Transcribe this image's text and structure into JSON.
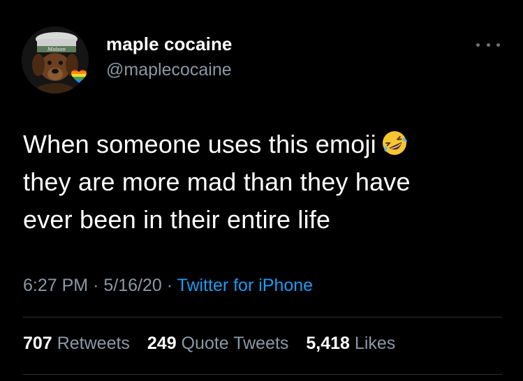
{
  "author": {
    "display_name": "maple cocaine",
    "handle": "@maplecocaine",
    "avatar_icon": "dog-avatar-icon",
    "badge_icon": "rainbow-heart-icon"
  },
  "tweet": {
    "lines": [
      "When someone uses this emoji",
      "they are more mad than they have",
      "ever been in their entire life"
    ],
    "emoji_icon": "rolling-on-floor-laughing-icon"
  },
  "meta": {
    "time": "6:27 PM",
    "separator": "·",
    "date": "5/16/20",
    "source": "Twitter for iPhone"
  },
  "stats": {
    "retweets_count": "707",
    "retweets_label": "Retweets",
    "quotes_count": "249",
    "quotes_label": "Quote Tweets",
    "likes_count": "5,418",
    "likes_label": "Likes"
  },
  "colors": {
    "background": "#000000",
    "text": "#ffffff",
    "secondary": "#8b98a5",
    "link": "#1d9bf0",
    "divider": "#2f3336"
  }
}
